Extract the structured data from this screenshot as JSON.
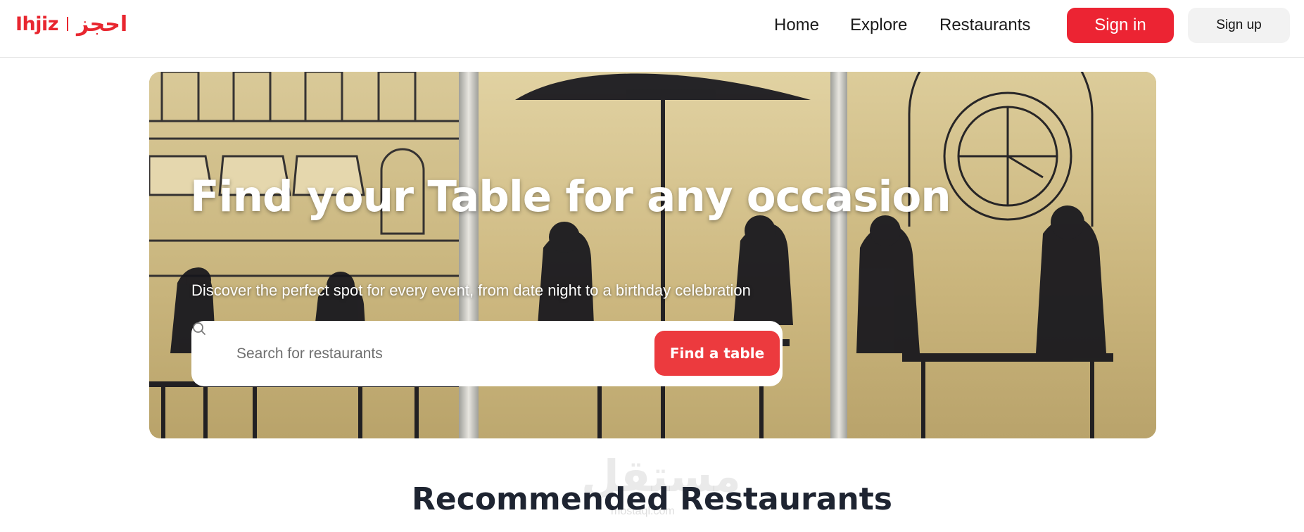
{
  "header": {
    "logo_latin": "Ihjiz",
    "logo_arabic": "احجز",
    "nav": [
      {
        "label": "Home"
      },
      {
        "label": "Explore"
      },
      {
        "label": "Restaurants"
      }
    ],
    "signin_label": "Sign in",
    "signup_label": "Sign up"
  },
  "hero": {
    "title": "Find your Table for any occasion",
    "subtitle": "Discover the perfect spot for every event, from date night to a birthday celebration",
    "search": {
      "placeholder": "Search for restaurants",
      "value": "",
      "button_label": "Find a table"
    }
  },
  "section": {
    "title": "Recommended Restaurants"
  },
  "watermark": {
    "text": "مستقل",
    "sub": "mostaql.com"
  },
  "colors": {
    "brand_red": "#ec2433",
    "find_button": "#ec3a3e",
    "heading_dark": "#1e2431"
  },
  "icons": {
    "search": "search-icon"
  }
}
